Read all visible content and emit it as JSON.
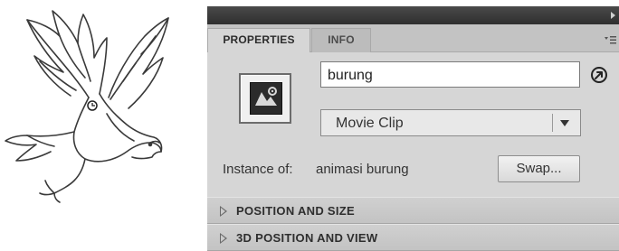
{
  "panel": {
    "tabs": [
      {
        "label": "PROPERTIES",
        "active": true
      },
      {
        "label": "INFO",
        "active": false
      }
    ]
  },
  "instance": {
    "name_value": "burung",
    "symbol_type": "Movie Clip",
    "instance_of_label": "Instance of:",
    "instance_of_value": "animasi burung",
    "swap_label": "Swap..."
  },
  "sections": [
    {
      "label": "POSITION AND SIZE",
      "expanded": false
    },
    {
      "label": "3D POSITION AND VIEW",
      "expanded": false
    }
  ],
  "icons": {
    "canvas_artwork": "eagle-drawing",
    "symbol_icon": "movie-clip-symbol-icon",
    "edit_icon": "edit-symbol-arrow-icon",
    "menu_icon": "panel-menu-icon"
  },
  "colors": {
    "panel_bg": "#d6d6d6",
    "topbar": "#3a3a3a",
    "section_header": "#c8c8c8"
  }
}
